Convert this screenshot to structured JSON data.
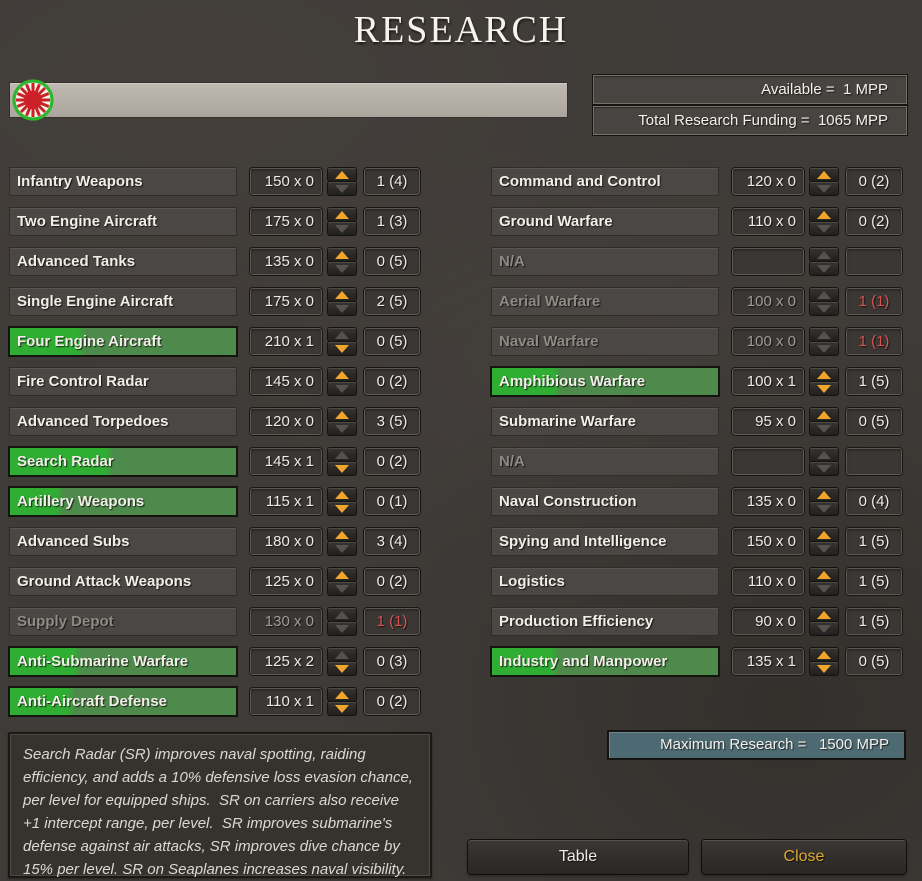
{
  "title": "RESEARCH",
  "header": {
    "flag_icon": "japan-rising-sun-flag",
    "available": "Available =  1 MPP",
    "total_funding": "Total Research Funding =  1065 MPP"
  },
  "columns": {
    "left": [
      {
        "name": "Infantry Weapons",
        "cost": "150 x 0",
        "result": "1 (4)",
        "state": "normal",
        "progress": 0,
        "up": true,
        "down": false,
        "result_red": false
      },
      {
        "name": "Two Engine Aircraft",
        "cost": "175 x 0",
        "result": "1 (3)",
        "state": "normal",
        "progress": 0,
        "up": true,
        "down": false,
        "result_red": false
      },
      {
        "name": "Advanced Tanks",
        "cost": "135 x 0",
        "result": "0 (5)",
        "state": "normal",
        "progress": 0,
        "up": true,
        "down": false,
        "result_red": false
      },
      {
        "name": "Single Engine Aircraft",
        "cost": "175 x 0",
        "result": "2 (5)",
        "state": "normal",
        "progress": 0,
        "up": true,
        "down": false,
        "result_red": false
      },
      {
        "name": "Four Engine Aircraft",
        "cost": "210 x 1",
        "result": "0 (5)",
        "state": "invested",
        "progress": 30,
        "up": false,
        "down": true,
        "result_red": false
      },
      {
        "name": "Fire Control Radar",
        "cost": "145 x 0",
        "result": "0 (2)",
        "state": "normal",
        "progress": 0,
        "up": true,
        "down": false,
        "result_red": false
      },
      {
        "name": "Advanced Torpedoes",
        "cost": "120 x 0",
        "result": "3 (5)",
        "state": "normal",
        "progress": 0,
        "up": true,
        "down": false,
        "result_red": false
      },
      {
        "name": "Search Radar",
        "cost": "145 x 1",
        "result": "0 (2)",
        "state": "invested",
        "progress": 42,
        "up": false,
        "down": true,
        "result_red": false
      },
      {
        "name": "Artillery Weapons",
        "cost": "115 x 1",
        "result": "0 (1)",
        "state": "invested",
        "progress": 20,
        "up": true,
        "down": true,
        "result_red": false
      },
      {
        "name": "Advanced Subs",
        "cost": "180 x 0",
        "result": "3 (4)",
        "state": "normal",
        "progress": 0,
        "up": true,
        "down": false,
        "result_red": false
      },
      {
        "name": "Ground Attack Weapons",
        "cost": "125 x 0",
        "result": "0 (2)",
        "state": "normal",
        "progress": 0,
        "up": true,
        "down": false,
        "result_red": false
      },
      {
        "name": "Supply Depot",
        "cost": "130 x 0",
        "result": "1 (1)",
        "state": "disabled",
        "progress": 0,
        "up": false,
        "down": false,
        "result_red": true
      },
      {
        "name": "Anti-Submarine Warfare",
        "cost": "125 x 2",
        "result": "0 (3)",
        "state": "invested",
        "progress": 28,
        "up": false,
        "down": true,
        "result_red": false
      },
      {
        "name": "Anti-Aircraft Defense",
        "cost": "110 x 1",
        "result": "0 (2)",
        "state": "invested",
        "progress": 25,
        "up": true,
        "down": true,
        "result_red": false
      }
    ],
    "right": [
      {
        "name": "Command and Control",
        "cost": "120 x 0",
        "result": "0 (2)",
        "state": "normal",
        "progress": 0,
        "up": true,
        "down": false,
        "result_red": false
      },
      {
        "name": "Ground Warfare",
        "cost": "110 x 0",
        "result": "0 (2)",
        "state": "normal",
        "progress": 0,
        "up": true,
        "down": false,
        "result_red": false
      },
      {
        "name": "N/A",
        "cost": "",
        "result": "",
        "state": "disabled",
        "progress": 0,
        "up": false,
        "down": false,
        "result_red": false
      },
      {
        "name": "Aerial Warfare",
        "cost": "100 x 0",
        "result": "1 (1)",
        "state": "disabled",
        "progress": 0,
        "up": false,
        "down": false,
        "result_red": true
      },
      {
        "name": "Naval Warfare",
        "cost": "100 x 0",
        "result": "1 (1)",
        "state": "disabled",
        "progress": 0,
        "up": false,
        "down": false,
        "result_red": true
      },
      {
        "name": "Amphibious Warfare",
        "cost": "100 x 1",
        "result": "1 (5)",
        "state": "invested",
        "progress": 27,
        "up": true,
        "down": true,
        "result_red": false
      },
      {
        "name": "Submarine Warfare",
        "cost": "95 x 0",
        "result": "0 (5)",
        "state": "normal",
        "progress": 0,
        "up": true,
        "down": false,
        "result_red": false
      },
      {
        "name": "N/A",
        "cost": "",
        "result": "",
        "state": "disabled",
        "progress": 0,
        "up": false,
        "down": false,
        "result_red": false
      },
      {
        "name": "Naval Construction",
        "cost": "135 x 0",
        "result": "0 (4)",
        "state": "normal",
        "progress": 0,
        "up": true,
        "down": false,
        "result_red": false
      },
      {
        "name": "Spying and Intelligence",
        "cost": "150 x 0",
        "result": "1 (5)",
        "state": "normal",
        "progress": 0,
        "up": true,
        "down": false,
        "result_red": false
      },
      {
        "name": "Logistics",
        "cost": "110 x 0",
        "result": "1 (5)",
        "state": "normal",
        "progress": 0,
        "up": true,
        "down": false,
        "result_red": false
      },
      {
        "name": "Production Efficiency",
        "cost": "90 x 0",
        "result": "1 (5)",
        "state": "normal",
        "progress": 0,
        "up": true,
        "down": false,
        "result_red": false
      },
      {
        "name": "Industry and Manpower",
        "cost": "135 x 1",
        "result": "0 (5)",
        "state": "invested",
        "progress": 26,
        "up": true,
        "down": true,
        "result_red": false
      }
    ]
  },
  "description": "Search Radar (SR) improves naval spotting, raiding efficiency, and adds a 10% defensive loss evasion chance, per level for equipped ships.  SR on carriers also receive +1 intercept range, per level.  SR improves submarine's defense against air attacks, SR improves dive chance by 15% per level. SR on Seaplanes increases naval visibility.",
  "footer": {
    "max_research": "Maximum Research =   1500 MPP",
    "table_button": "Table",
    "close_button": "Close"
  },
  "colors": {
    "green_bright": "#2fae33",
    "green_dark": "#4d8a4b",
    "arrow_active": "#f2a52c",
    "arrow_inactive": "#56524d",
    "result_red": "#da5252",
    "max_research_bg": "#4d6a73",
    "close_text": "#e0a92f",
    "flag_ring_green": "#2db52d",
    "flag_red": "#cc2027"
  }
}
